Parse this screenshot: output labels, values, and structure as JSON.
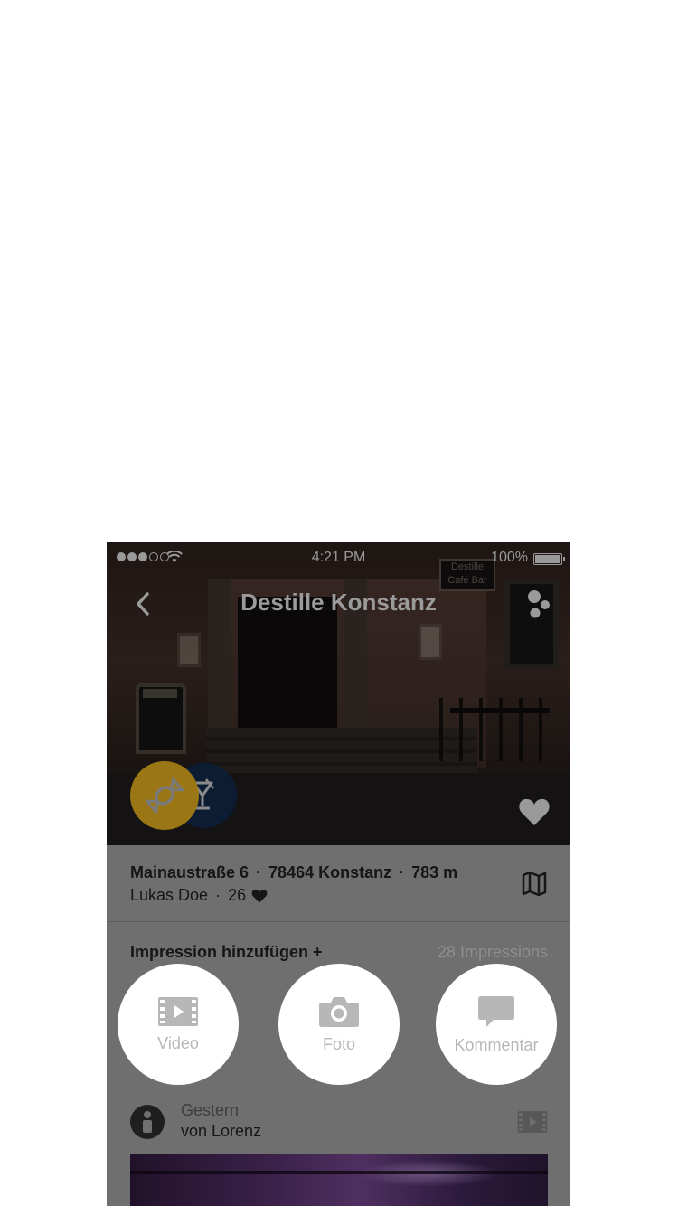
{
  "status_bar": {
    "time": "4:21 PM",
    "battery": "100%"
  },
  "nav": {
    "title": "Destille Konstanz",
    "back_icon": "chevron-left-icon",
    "more_icon": "more-dots-icon"
  },
  "hero": {
    "sign_text_1": "Destille",
    "sign_text_2": "Café Bar",
    "categories": [
      {
        "icon": "candy-icon",
        "color": "#9a7614"
      },
      {
        "icon": "cocktail-icon",
        "color": "#0c1c33"
      }
    ],
    "favorite_icon": "heart-icon"
  },
  "info": {
    "street": "Mainaustraße 6",
    "city": "78464 Konstanz",
    "distance": "783 m",
    "owner": "Lukas Doe",
    "likes": "26",
    "separator": "·",
    "map_icon": "map-icon"
  },
  "impressions": {
    "add_label": "Impression hinzufügen +",
    "count_label": "28 Impressions",
    "actions": [
      {
        "label": "Video",
        "icon": "film-icon"
      },
      {
        "label": "Foto",
        "icon": "camera-icon"
      },
      {
        "label": "Kommentar",
        "icon": "comment-icon"
      }
    ]
  },
  "feed": {
    "items": [
      {
        "when": "Gestern",
        "by": "von Lorenz",
        "type_icon": "film-icon"
      }
    ]
  },
  "colors": {
    "overlay_gray": "#6f6f6f",
    "text_dark": "#161616",
    "muted": "#8e8e8e",
    "accent_yellow": "#9a7614",
    "accent_blue": "#0c1c33"
  }
}
